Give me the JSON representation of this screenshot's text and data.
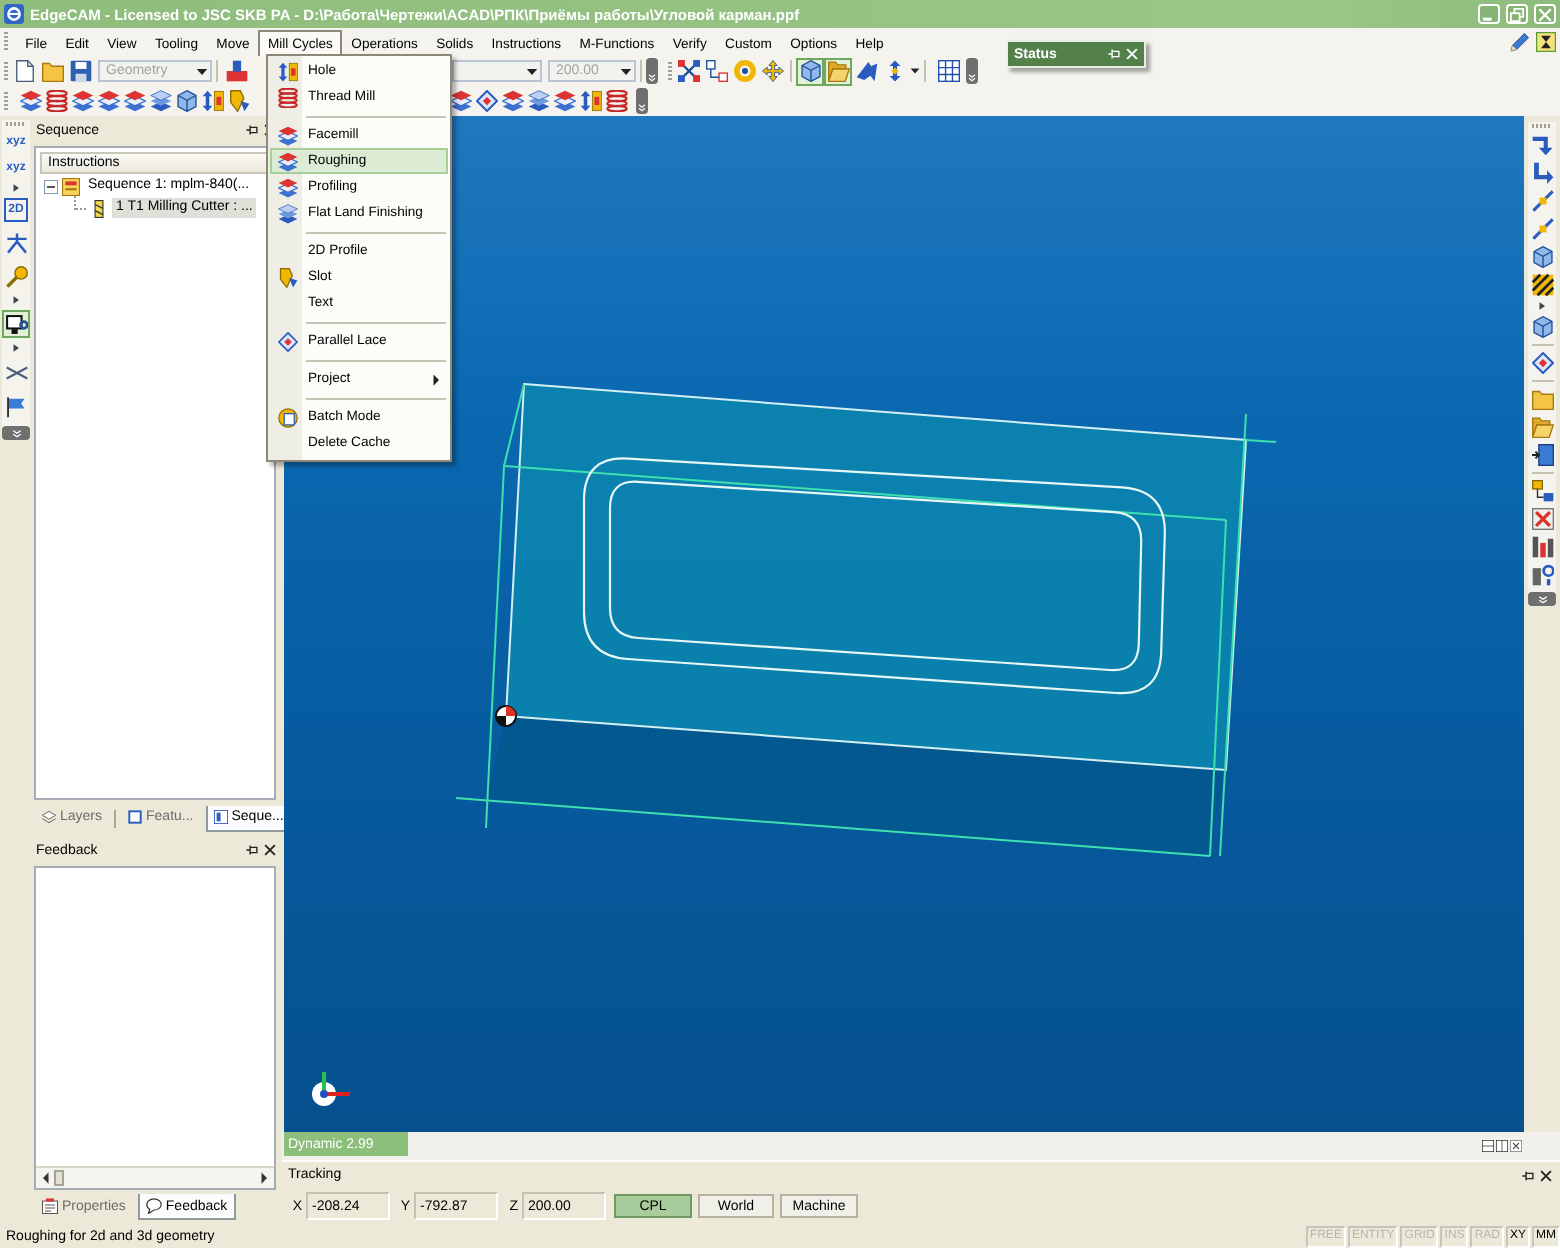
{
  "window": {
    "title": "EdgeCAM - Licensed to JSC SKB PA - D:\\Работа\\Чертежи\\ACAD\\РПК\\Приёмы работы\\Угловой карман.ppf"
  },
  "menu_bar": [
    {
      "label": "File",
      "selected": false
    },
    {
      "label": "Edit",
      "selected": false
    },
    {
      "label": "View",
      "selected": false
    },
    {
      "label": "Tooling",
      "selected": false
    },
    {
      "label": "Move",
      "selected": false
    },
    {
      "label": "Mill Cycles",
      "selected": true
    },
    {
      "label": "Operations",
      "selected": false
    },
    {
      "label": "Solids",
      "selected": false
    },
    {
      "label": "Instructions",
      "selected": false
    },
    {
      "label": "M-Functions",
      "selected": false
    },
    {
      "label": "Verify",
      "selected": false
    },
    {
      "label": "Custom",
      "selected": false
    },
    {
      "label": "Options",
      "selected": false
    },
    {
      "label": "Help",
      "selected": false
    }
  ],
  "toolbar": {
    "layer_combo": {
      "value": "Geometry",
      "disabled": true
    },
    "value_combo": {
      "value": "200.00",
      "disabled": true
    },
    "view_buttons": [
      {
        "pressed": true
      },
      {
        "pressed": true
      },
      {
        "pressed": false
      },
      {
        "pressed": false
      }
    ]
  },
  "status_window": {
    "title": "Status"
  },
  "left_toolbar": [
    {
      "kind": "text",
      "label": "xyz"
    },
    {
      "kind": "text",
      "label": "xyz"
    },
    {
      "kind": "boxed_text",
      "label": "2D"
    },
    {
      "kind": "button",
      "pressed": false
    },
    {
      "kind": "button",
      "pressed": false
    },
    {
      "kind": "button",
      "pressed": true
    },
    {
      "kind": "button",
      "pressed": false
    },
    {
      "kind": "button",
      "pressed": false
    }
  ],
  "sequence_panel": {
    "title": "Sequence",
    "column": "Instructions",
    "tree": [
      {
        "label": "Sequence 1: mplm-840(...",
        "expanded": true,
        "selected": false,
        "children": [
          {
            "label": "1 T1 Milling Cutter : ...",
            "selected": true
          }
        ]
      }
    ],
    "tabs": [
      {
        "label": "Layers",
        "selected": false
      },
      {
        "label": "Featu...",
        "selected": false
      },
      {
        "label": "Seque...",
        "selected": true
      }
    ]
  },
  "feedback_panel": {
    "title": "Feedback",
    "tabs": [
      {
        "label": "Properties",
        "selected": false
      },
      {
        "label": "Feedback",
        "selected": true
      }
    ]
  },
  "mill_cycles_menu": [
    {
      "kind": "item",
      "label": "Hole",
      "selected": false
    },
    {
      "kind": "item",
      "label": "Thread Mill",
      "selected": false
    },
    {
      "kind": "separator"
    },
    {
      "kind": "item",
      "label": "Facemill",
      "selected": false
    },
    {
      "kind": "item",
      "label": "Roughing",
      "selected": true
    },
    {
      "kind": "item",
      "label": "Profiling",
      "selected": false
    },
    {
      "kind": "item",
      "label": "Flat Land Finishing",
      "selected": false
    },
    {
      "kind": "separator"
    },
    {
      "kind": "item",
      "label": "2D Profile",
      "selected": false
    },
    {
      "kind": "item",
      "label": "Slot",
      "selected": false
    },
    {
      "kind": "item",
      "label": "Text",
      "selected": false
    },
    {
      "kind": "separator"
    },
    {
      "kind": "item",
      "label": "Parallel Lace",
      "selected": false
    },
    {
      "kind": "separator"
    },
    {
      "kind": "submenu",
      "label": "Project",
      "selected": false
    },
    {
      "kind": "separator"
    },
    {
      "kind": "item",
      "label": "Batch Mode",
      "selected": false
    },
    {
      "kind": "item",
      "label": "Delete Cache",
      "selected": false
    }
  ],
  "viewport": {
    "status_label": "Dynamic 2.99"
  },
  "tracking": {
    "title": "Tracking",
    "fields": [
      {
        "axis": "X",
        "value": "-208.24"
      },
      {
        "axis": "Y",
        "value": "-792.87"
      },
      {
        "axis": "Z",
        "value": "200.00"
      }
    ],
    "modes": [
      {
        "label": "CPL",
        "selected": true
      },
      {
        "label": "World",
        "selected": false
      },
      {
        "label": "Machine",
        "selected": false
      }
    ]
  },
  "status_bar": {
    "message": "Roughing for 2d and 3d geometry",
    "indicators": [
      {
        "label": "FREE",
        "on": false
      },
      {
        "label": "ENTITY",
        "on": false
      },
      {
        "label": "GRID",
        "on": false
      },
      {
        "label": "INS",
        "on": false
      },
      {
        "label": "RAD",
        "on": false
      },
      {
        "label": "XY",
        "on": true
      },
      {
        "label": "MM",
        "on": true
      }
    ]
  }
}
